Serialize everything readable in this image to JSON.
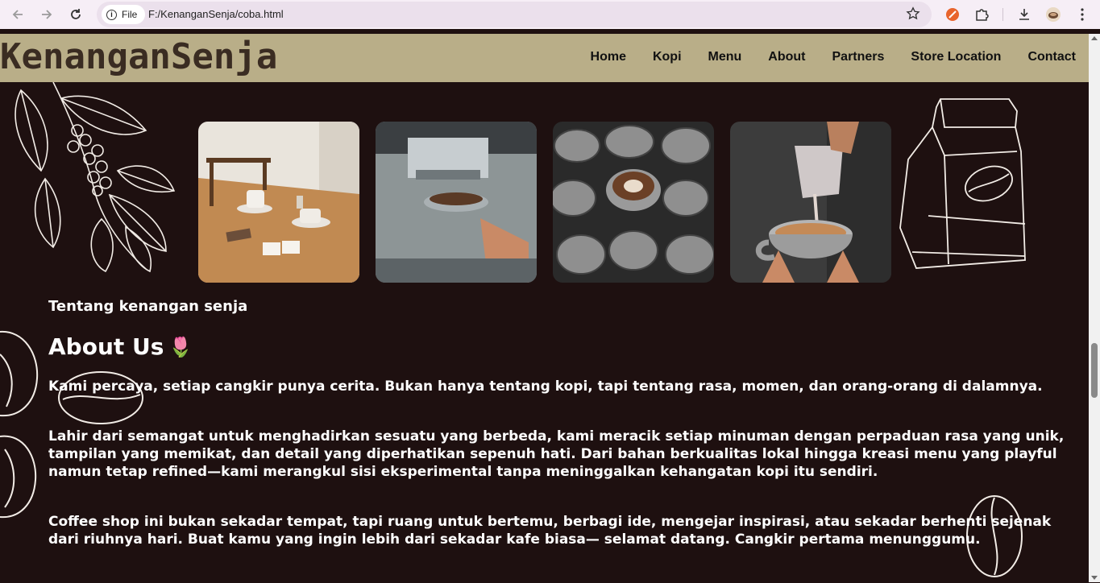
{
  "browser": {
    "chip_label": "File",
    "url": "F:/KenanganSenja/coba.html",
    "icons": [
      "back-icon",
      "forward-icon",
      "reload-icon",
      "info-icon",
      "star-icon",
      "extension-icon",
      "puzzle-icon",
      "download-icon",
      "profile-icon",
      "more-icon"
    ]
  },
  "site": {
    "logo": "KenanganSenja",
    "nav": [
      "Home",
      "Kopi",
      "Menu",
      "About",
      "Partners",
      "Store Location",
      "Contact"
    ]
  },
  "gallery": [
    "cafe-table-photo",
    "espresso-machine-photo",
    "cups-latte-art-photo",
    "pouring-latte-photo"
  ],
  "about": {
    "subtitle": "Tentang kenangan senja",
    "title": "About Us",
    "emoji": "🌷",
    "paragraphs": [
      "Kami percaya, setiap cangkir punya cerita. Bukan hanya tentang kopi, tapi tentang rasa, momen, dan orang-orang di dalamnya.",
      "Lahir dari semangat untuk menghadirkan sesuatu yang berbeda, kami meracik setiap minuman dengan perpaduan rasa yang unik, tampilan yang memikat, dan detail yang diperhatikan sepenuh hati. Dari bahan berkualitas lokal hingga kreasi menu yang playful namun tetap refined—kami merangkul sisi eksperimental tanpa meninggalkan kehangatan kopi itu sendiri.",
      "Coffee shop ini bukan sekadar tempat, tapi ruang untuk bertemu, berbagi ide, mengejar inspirasi, atau sekadar berhenti sejenak dari riuhnya hari. Buat kamu yang ingin lebih dari sekadar kafe biasa— selamat datang. Cangkir pertama menunggumu."
    ]
  },
  "colors": {
    "page_bg": "#1e1010",
    "header_bg": "#b9ae88",
    "logo": "#3a2c22"
  }
}
